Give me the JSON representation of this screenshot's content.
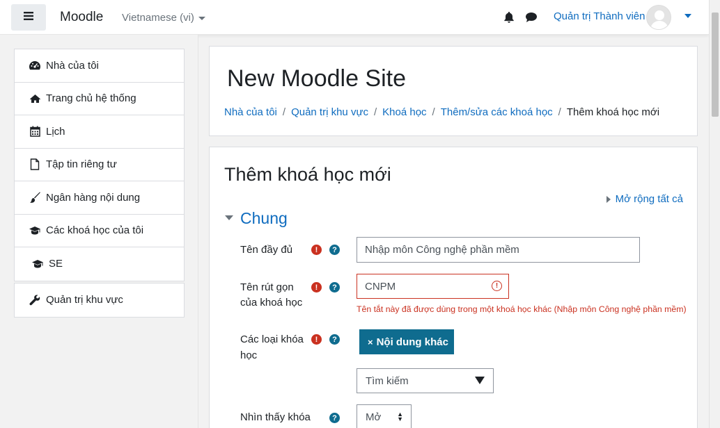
{
  "navbar": {
    "brand": "Moodle",
    "language": "Vietnamese (vi)",
    "user_name": "Quản trị Thành viên"
  },
  "drawer": {
    "items": [
      {
        "label": "Nhà của tôi",
        "icon": "dashboard-icon"
      },
      {
        "label": "Trang chủ hệ thống",
        "icon": "home-icon"
      },
      {
        "label": "Lịch",
        "icon": "calendar-icon"
      },
      {
        "label": "Tập tin riêng tư",
        "icon": "file-icon"
      },
      {
        "label": "Ngân hàng nội dung",
        "icon": "paintbrush-icon"
      },
      {
        "label": "Các khoá học của tôi",
        "icon": "graduation-cap-icon"
      },
      {
        "label": "SE",
        "icon": "graduation-cap-icon"
      }
    ],
    "admin_item": {
      "label": "Quản trị khu vực",
      "icon": "wrench-icon"
    }
  },
  "header": {
    "site_title": "New Moodle Site",
    "breadcrumb": [
      "Nhà của tôi",
      "Quản trị khu vực",
      "Khoá học",
      "Thêm/sửa các khoá học"
    ],
    "breadcrumb_current": "Thêm khoá học mới"
  },
  "form": {
    "title": "Thêm khoá học mới",
    "expand_all": "Mở rộng tất cả",
    "section": "Chung",
    "fullname": {
      "label": "Tên đầy đủ",
      "value": "Nhập môn Công nghệ phần mềm"
    },
    "shortname": {
      "label_line1": "Tên rút gọn",
      "label_line2": "của khoá học",
      "value": "CNPM",
      "error": "Tên tắt này đã được dùng trong một khoá học khác (Nhập môn Công nghệ phần mềm)"
    },
    "category": {
      "label_line1": "Các loại khóa",
      "label_line2": "học",
      "selected": "Nội dung khác",
      "search_placeholder": "Tìm kiếm"
    },
    "visibility": {
      "label": "Nhìn thấy khóa",
      "value": "Mở"
    }
  },
  "colors": {
    "link": "#0f6cbf",
    "error": "#ca3120",
    "tag_bg": "#0f6c8f"
  }
}
